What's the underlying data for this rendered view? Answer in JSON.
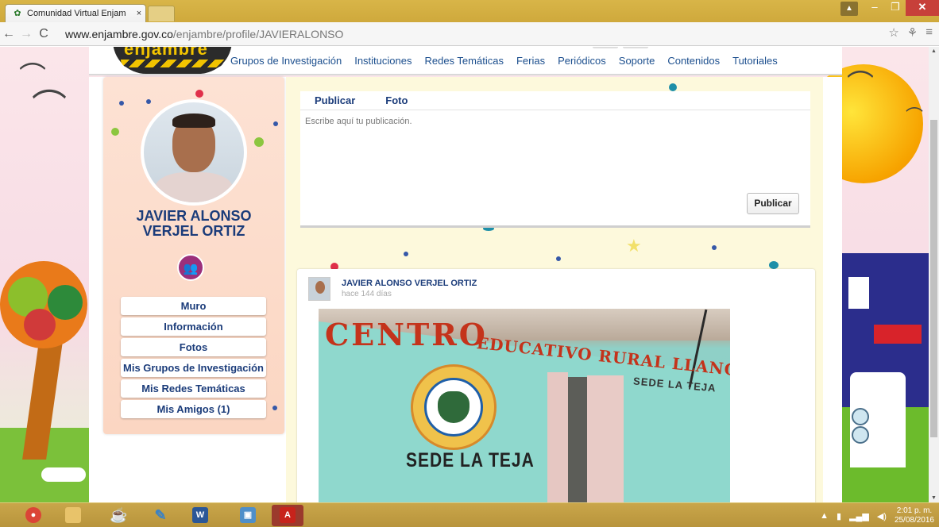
{
  "browser": {
    "tab_title": "Comunidad Virtual Enjam",
    "tab_close": "×",
    "url_host": "www.enjambre.gov.co",
    "url_path": "/enjambre/profile/JAVIERALONSO"
  },
  "site": {
    "logo_text": "enjambre",
    "menu": [
      "Grupos de Investigación",
      "Instituciones",
      "Redes Temáticas",
      "Ferias",
      "Periódicos",
      "Soporte",
      "Contenidos",
      "Tutoriales"
    ]
  },
  "profile": {
    "name_line1": "JAVIER ALONSO",
    "name_line2": "VERJEL ORTIZ",
    "menu": [
      "Muro",
      "Información",
      "Fotos",
      "Mis Grupos de Investigación",
      "Mis Redes Temáticas",
      "Mis Amigos (1)"
    ]
  },
  "composer": {
    "tab_publicar": "Publicar",
    "tab_foto": "Foto",
    "placeholder": "Escribe aquí tu publicación.",
    "button": "Publicar"
  },
  "post": {
    "author": "JAVIER ALONSO VERJEL ORTIZ",
    "time": "hace 144 días",
    "photo_sign": "CENTRO",
    "photo_sign2": "EDUCATIVO RURAL LLANO ALTO",
    "photo_sign3": "SEDE LA TEJA",
    "photo_sede": "SEDE LA TEJA"
  },
  "taskbar": {
    "time": "2:01 p. m.",
    "date": "25/08/2016"
  },
  "colors": {
    "link_blue": "#1b3c7a",
    "menu_blue": "#1c4f8e",
    "profile_bg": "#fbd6c2",
    "feed_bg": "#fdf9dc",
    "chrome_gold": "#cfa93c"
  }
}
